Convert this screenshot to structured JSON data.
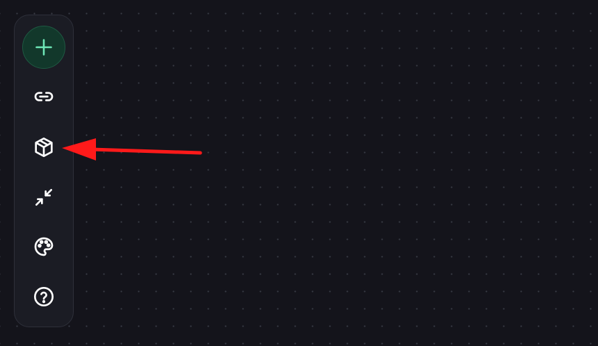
{
  "canvas": {
    "background": "#14141b",
    "grid": "dotted"
  },
  "toolbar": {
    "items": [
      {
        "id": "add",
        "icon": "plus-icon",
        "label": "",
        "color": "#6ee7b7"
      },
      {
        "id": "link",
        "icon": "link-icon",
        "label": ""
      },
      {
        "id": "package",
        "icon": "cube-icon",
        "label": ""
      },
      {
        "id": "collapse",
        "icon": "collapse-arrows-icon",
        "label": ""
      },
      {
        "id": "theme",
        "icon": "palette-icon",
        "label": ""
      },
      {
        "id": "help",
        "icon": "question-circle-icon",
        "label": ""
      }
    ]
  },
  "annotation": {
    "type": "arrow",
    "color": "#ff1a1a",
    "points_to": "package"
  }
}
